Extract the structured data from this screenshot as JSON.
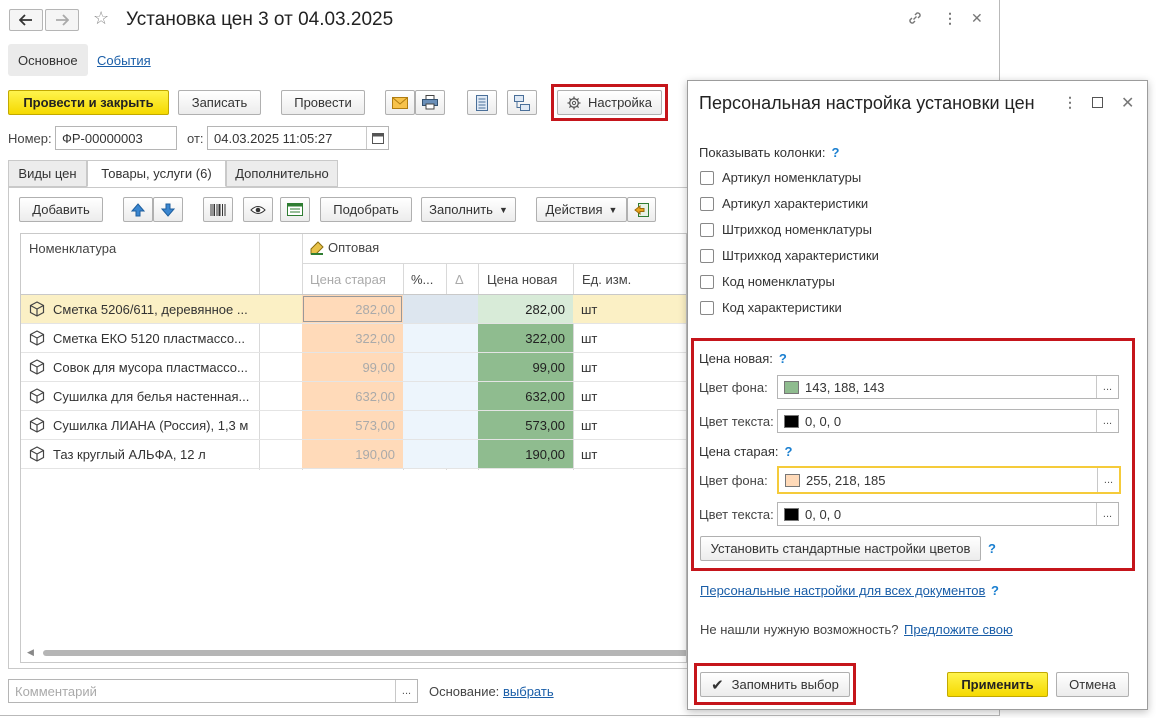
{
  "window": {
    "title": "Установка цен 3 от 04.03.2025",
    "back_icon": "arrow-left-icon",
    "forward_icon": "arrow-right-icon",
    "star_icon": "star-icon",
    "link_icon": "link-icon",
    "more_icon": "more-vertical-icon",
    "close_icon": "close-icon"
  },
  "top_tabs": {
    "main": "Основное",
    "events": "События"
  },
  "toolbar": {
    "post_close": "Провести и закрыть",
    "save": "Записать",
    "post": "Провести",
    "settings": "Настройка"
  },
  "header": {
    "number_label": "Номер:",
    "number_value": "ФР-00000003",
    "date_label": "от:",
    "date_value": "04.03.2025 11:05:27"
  },
  "tabs": {
    "price_types": "Виды цен",
    "goods": "Товары, услуги (6)",
    "additional": "Дополнительно"
  },
  "grid_toolbar": {
    "add": "Добавить",
    "pick": "Подобрать",
    "fill": "Заполнить",
    "actions": "Действия"
  },
  "grid": {
    "col_name": "Номенклатура",
    "group_wholesale": "Оптовая",
    "col_old": "Цена старая",
    "col_pct": "%...",
    "col_delta": "Δ",
    "col_new": "Цена новая",
    "col_unit": "Ед. изм.",
    "rows": [
      {
        "name": "Сметка 5206/611, деревянное ...",
        "old": "282,00",
        "new": "282,00",
        "unit": "шт"
      },
      {
        "name": "Сметка ЕКО 5120 пластмассо...",
        "old": "322,00",
        "new": "322,00",
        "unit": "шт"
      },
      {
        "name": "Совок для мусора пластмассо...",
        "old": "99,00",
        "new": "99,00",
        "unit": "шт"
      },
      {
        "name": "Сушилка для белья настенная...",
        "old": "632,00",
        "new": "632,00",
        "unit": "шт"
      },
      {
        "name": "Сушилка ЛИАНА (Россия), 1,3 м",
        "old": "573,00",
        "new": "573,00",
        "unit": "шт"
      },
      {
        "name": "Таз круглый АЛЬФА, 12 л",
        "old": "190,00",
        "new": "190,00",
        "unit": "шт"
      }
    ]
  },
  "footer": {
    "comment_placeholder": "Комментарий",
    "basis_label": "Основание:",
    "basis_link": "выбрать"
  },
  "dialog": {
    "title": "Персональная настройка установки цен",
    "show_columns_label": "Показывать колонки:",
    "checkboxes": [
      "Артикул номенклатуры",
      "Артикул характеристики",
      "Штрихкод номенклатуры",
      "Штрихкод характеристики",
      "Код номенклатуры",
      "Код характеристики"
    ],
    "new_price_label": "Цена новая:",
    "old_price_label": "Цена старая:",
    "bg_color_label": "Цвет фона:",
    "text_color_label": "Цвет текста:",
    "new_bg_value": "143, 188, 143",
    "new_text_value": "0, 0, 0",
    "old_bg_value": "255, 218, 185",
    "old_text_value": "0, 0, 0",
    "reset_colors": "Установить стандартные настройки цветов",
    "personal_all_docs": "Персональные настройки для всех документов",
    "not_found_text": "Не нашли нужную возможность?",
    "suggest_link": "Предложите свою",
    "remember_choice": "Запомнить выбор",
    "apply": "Применить",
    "cancel": "Отмена",
    "help_mark": "?"
  },
  "colors": {
    "new_price_bg": "#8fbc8f",
    "old_price_bg": "#ffdab9",
    "accent_yellow": "#f5d900",
    "highlight_red": "#c5151b"
  }
}
